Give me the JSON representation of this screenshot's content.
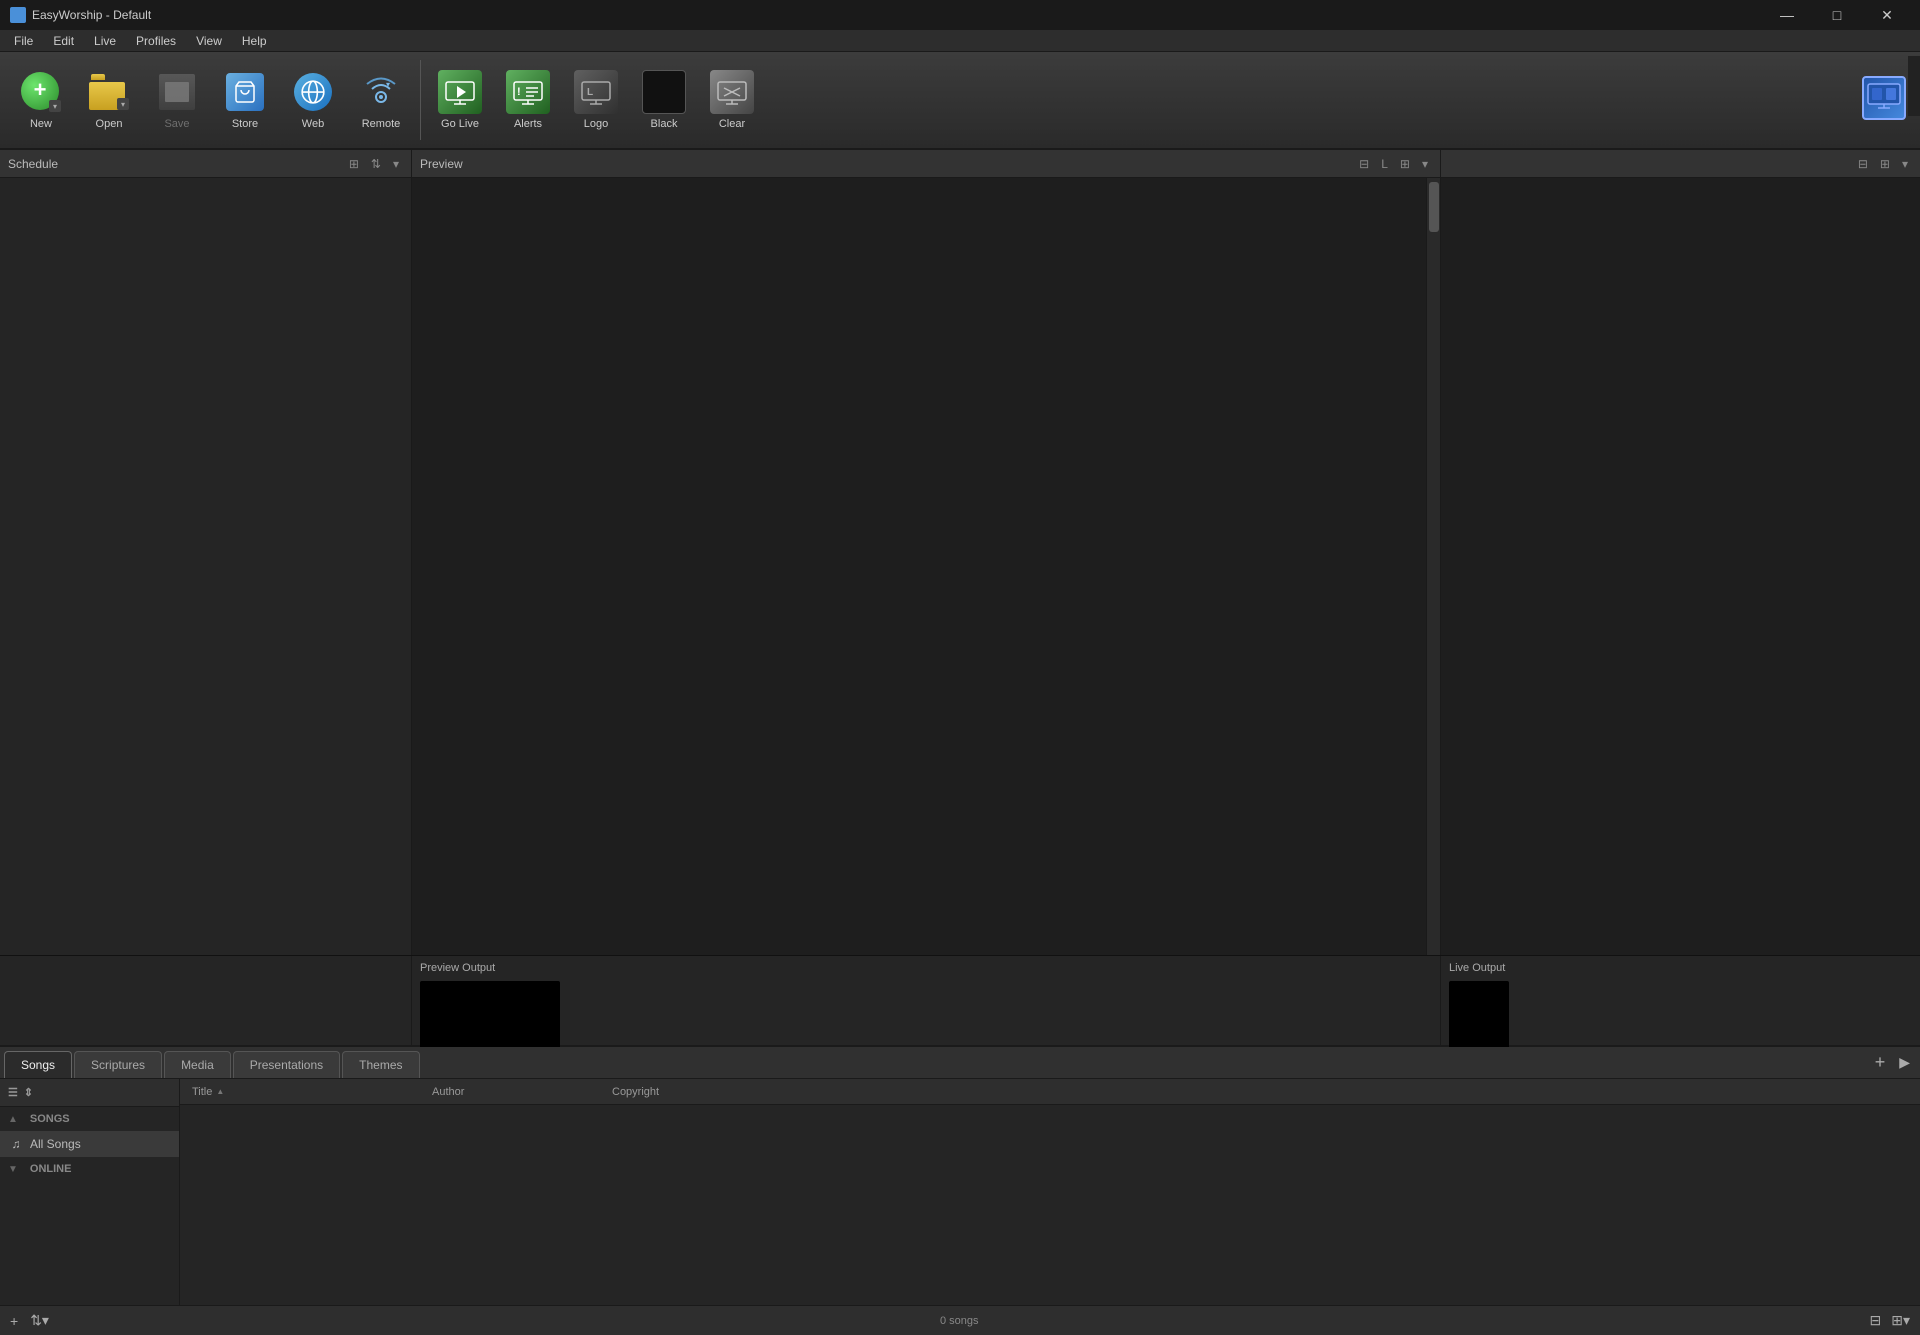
{
  "app": {
    "title": "EasyWorship - Default",
    "icon": "ew"
  },
  "titlebar": {
    "minimize_label": "—",
    "maximize_label": "□",
    "close_label": "✕"
  },
  "menubar": {
    "items": [
      {
        "id": "file",
        "label": "File"
      },
      {
        "id": "edit",
        "label": "Edit"
      },
      {
        "id": "live",
        "label": "Live"
      },
      {
        "id": "profiles",
        "label": "Profiles"
      },
      {
        "id": "view",
        "label": "View"
      },
      {
        "id": "help",
        "label": "Help"
      }
    ]
  },
  "toolbar": {
    "new_label": "New",
    "open_label": "Open",
    "save_label": "Save",
    "store_label": "Store",
    "web_label": "Web",
    "remote_label": "Remote",
    "golive_label": "Go Live",
    "alerts_label": "Alerts",
    "logo_label": "Logo",
    "black_label": "Black",
    "clear_label": "Clear",
    "liveoutput_label": ""
  },
  "schedule": {
    "title": "Schedule"
  },
  "preview": {
    "title": "Preview",
    "output_label": "Preview Output"
  },
  "live": {
    "title": "",
    "output_label": "Live Output"
  },
  "library": {
    "tabs": [
      {
        "id": "songs",
        "label": "Songs",
        "active": true
      },
      {
        "id": "scriptures",
        "label": "Scriptures"
      },
      {
        "id": "media",
        "label": "Media"
      },
      {
        "id": "presentations",
        "label": "Presentations"
      },
      {
        "id": "themes",
        "label": "Themes"
      }
    ],
    "sidebar": {
      "songs_section": "SONGS",
      "all_songs_label": "All Songs",
      "online_section": "ONLINE"
    },
    "table": {
      "col_title": "Title",
      "col_author": "Author",
      "col_copyright": "Copyright"
    },
    "song_count": "0 songs"
  }
}
